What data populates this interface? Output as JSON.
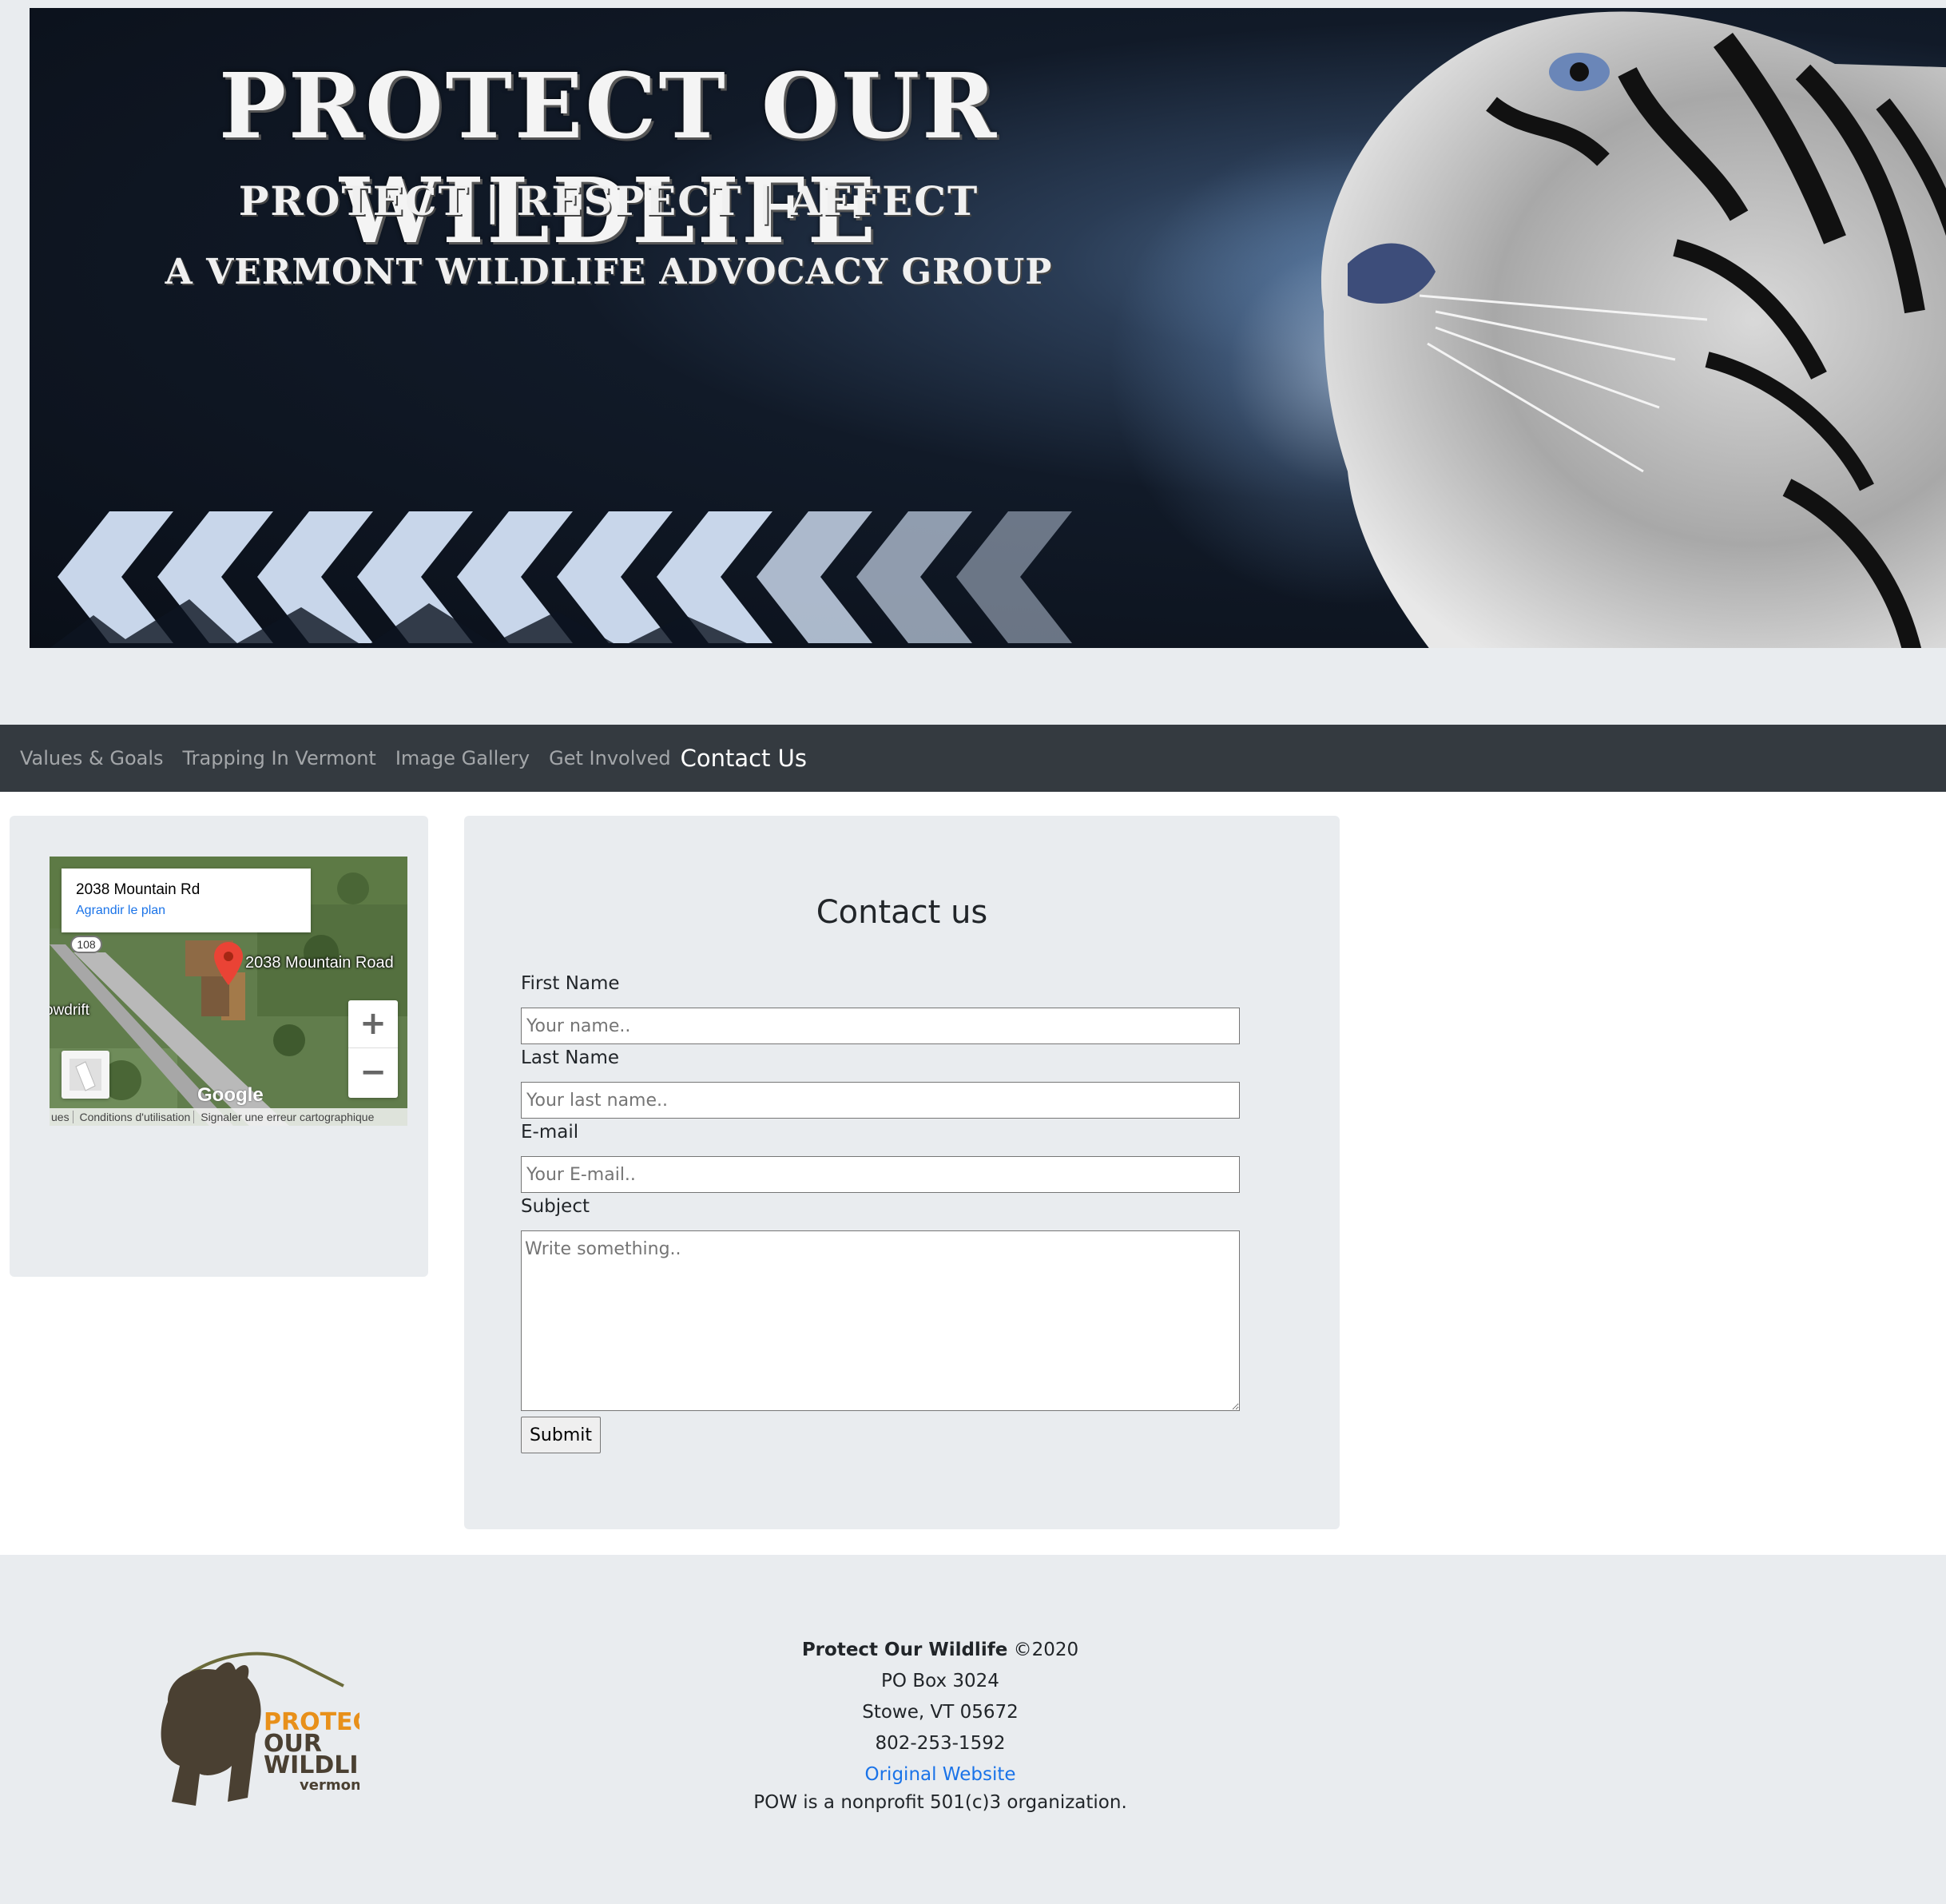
{
  "banner": {
    "title": "PROTECT OUR WILDLIFE",
    "subtitle": "PROTECT | RESPECT | AFFECT",
    "tagline": "A VERMONT WILDLIFE ADVOCACY GROUP"
  },
  "nav": {
    "items": [
      {
        "label": "Values & Goals"
      },
      {
        "label": "Trapping In Vermont"
      },
      {
        "label": "Image Gallery"
      },
      {
        "label": "Get Involved"
      },
      {
        "label": "Contact Us"
      }
    ]
  },
  "map": {
    "address": "2038 Mountain Rd",
    "enlarge_link": "Agrandir le plan",
    "place_label": "2038 Mountain Road",
    "road_shield": "108",
    "area_label": "owdrift",
    "google": "Google",
    "footer": [
      "ues",
      "Conditions d'utilisation",
      "Signaler une erreur cartographique"
    ],
    "zoom_in": "+",
    "zoom_out": "−"
  },
  "form": {
    "title": "Contact us",
    "first_name_label": "First Name",
    "first_name_placeholder": "Your name..",
    "last_name_label": "Last Name",
    "last_name_placeholder": "Your last name..",
    "email_label": "E-mail",
    "email_placeholder": "Your E-mail..",
    "subject_label": "Subject",
    "subject_placeholder": "Write something..",
    "submit_label": "Submit"
  },
  "footer": {
    "brand": "Protect Our Wildlife",
    "copyright": "©2020",
    "po_box": "PO Box 3024",
    "city": "Stowe, VT 05672",
    "phone": "802-253-1592",
    "link": "Original Website",
    "nonprofit": "POW is a nonprofit 501(c)3 organization.",
    "logo_words": [
      "PROTECT",
      "OUR",
      "WILDLIFE",
      "vermont"
    ]
  },
  "colors": {
    "nav_bg": "#343a40",
    "card_bg": "#e9ecef",
    "link": "#1a73e8",
    "logo_orange": "#e8901a",
    "logo_brown": "#4a4032"
  }
}
